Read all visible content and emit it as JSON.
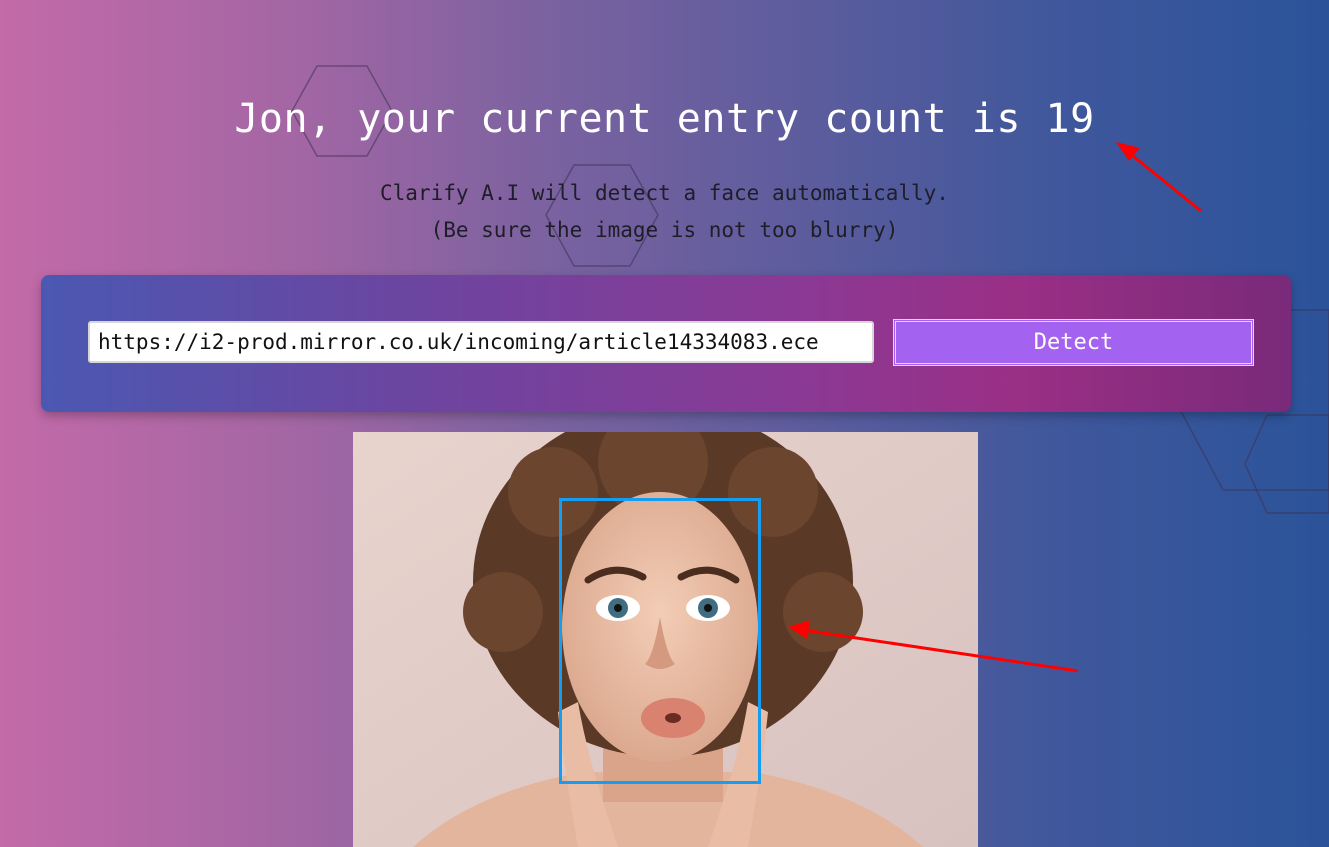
{
  "header": {
    "greeting": "Jon, your current entry count is 19"
  },
  "instructions": {
    "line1": "Clarify A.I will detect a face automatically.",
    "line2": "(Be sure the image is not too blurry)"
  },
  "image_form": {
    "url_value": "https://i2-prod.mirror.co.uk/incoming/article14334083.ece",
    "detect_label": "Detect"
  },
  "colors": {
    "accent": "#a462f0",
    "face_box": "#149df2",
    "annotation_arrow": "#ff0000"
  },
  "icons": {
    "background_decor": "hexagon-outline",
    "annotation": "red-arrow"
  }
}
